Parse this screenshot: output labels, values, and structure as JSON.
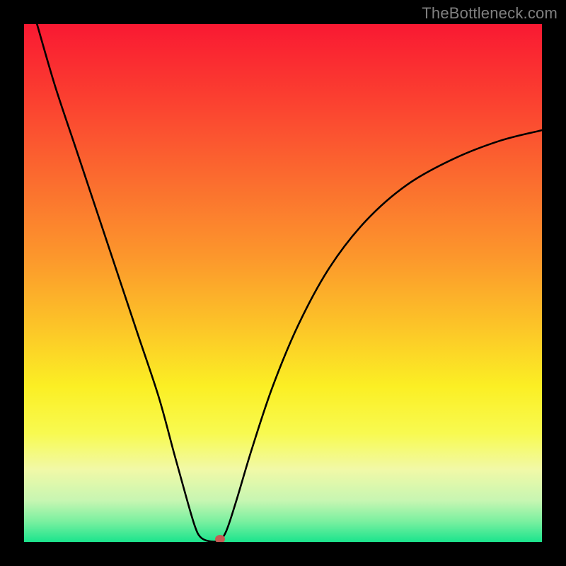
{
  "watermark": "TheBottleneck.com",
  "chart_data": {
    "type": "line",
    "title": "",
    "xlabel": "",
    "ylabel": "",
    "xlim": [
      0,
      100
    ],
    "ylim": [
      0,
      100
    ],
    "gradient_stops": [
      {
        "pct": 0,
        "color": "#f91932"
      },
      {
        "pct": 15,
        "color": "#fb4130"
      },
      {
        "pct": 30,
        "color": "#fb6c2f"
      },
      {
        "pct": 45,
        "color": "#fc972c"
      },
      {
        "pct": 58,
        "color": "#fcc328"
      },
      {
        "pct": 70,
        "color": "#fbef24"
      },
      {
        "pct": 79,
        "color": "#f8fa50"
      },
      {
        "pct": 86,
        "color": "#f1f9a7"
      },
      {
        "pct": 92,
        "color": "#c7f6b2"
      },
      {
        "pct": 96,
        "color": "#7bf0a0"
      },
      {
        "pct": 100,
        "color": "#1be48d"
      }
    ],
    "series": [
      {
        "name": "bottleneck-curve",
        "points": [
          {
            "x": 2.5,
            "y": 100
          },
          {
            "x": 6,
            "y": 88
          },
          {
            "x": 10,
            "y": 76
          },
          {
            "x": 14,
            "y": 64
          },
          {
            "x": 18,
            "y": 52
          },
          {
            "x": 22,
            "y": 40
          },
          {
            "x": 26,
            "y": 28
          },
          {
            "x": 29,
            "y": 17
          },
          {
            "x": 31.5,
            "y": 8
          },
          {
            "x": 33,
            "y": 3
          },
          {
            "x": 34,
            "y": 1
          },
          {
            "x": 35.5,
            "y": 0.2
          },
          {
            "x": 37.5,
            "y": 0.2
          },
          {
            "x": 39,
            "y": 2
          },
          {
            "x": 41,
            "y": 8
          },
          {
            "x": 44,
            "y": 18
          },
          {
            "x": 48,
            "y": 30
          },
          {
            "x": 53,
            "y": 42
          },
          {
            "x": 59,
            "y": 53
          },
          {
            "x": 66,
            "y": 62
          },
          {
            "x": 74,
            "y": 69
          },
          {
            "x": 83,
            "y": 74
          },
          {
            "x": 92,
            "y": 77.5
          },
          {
            "x": 100,
            "y": 79.5
          }
        ]
      }
    ],
    "marker": {
      "x": 37.8,
      "y": 0.5,
      "color": "#c65a53"
    }
  }
}
